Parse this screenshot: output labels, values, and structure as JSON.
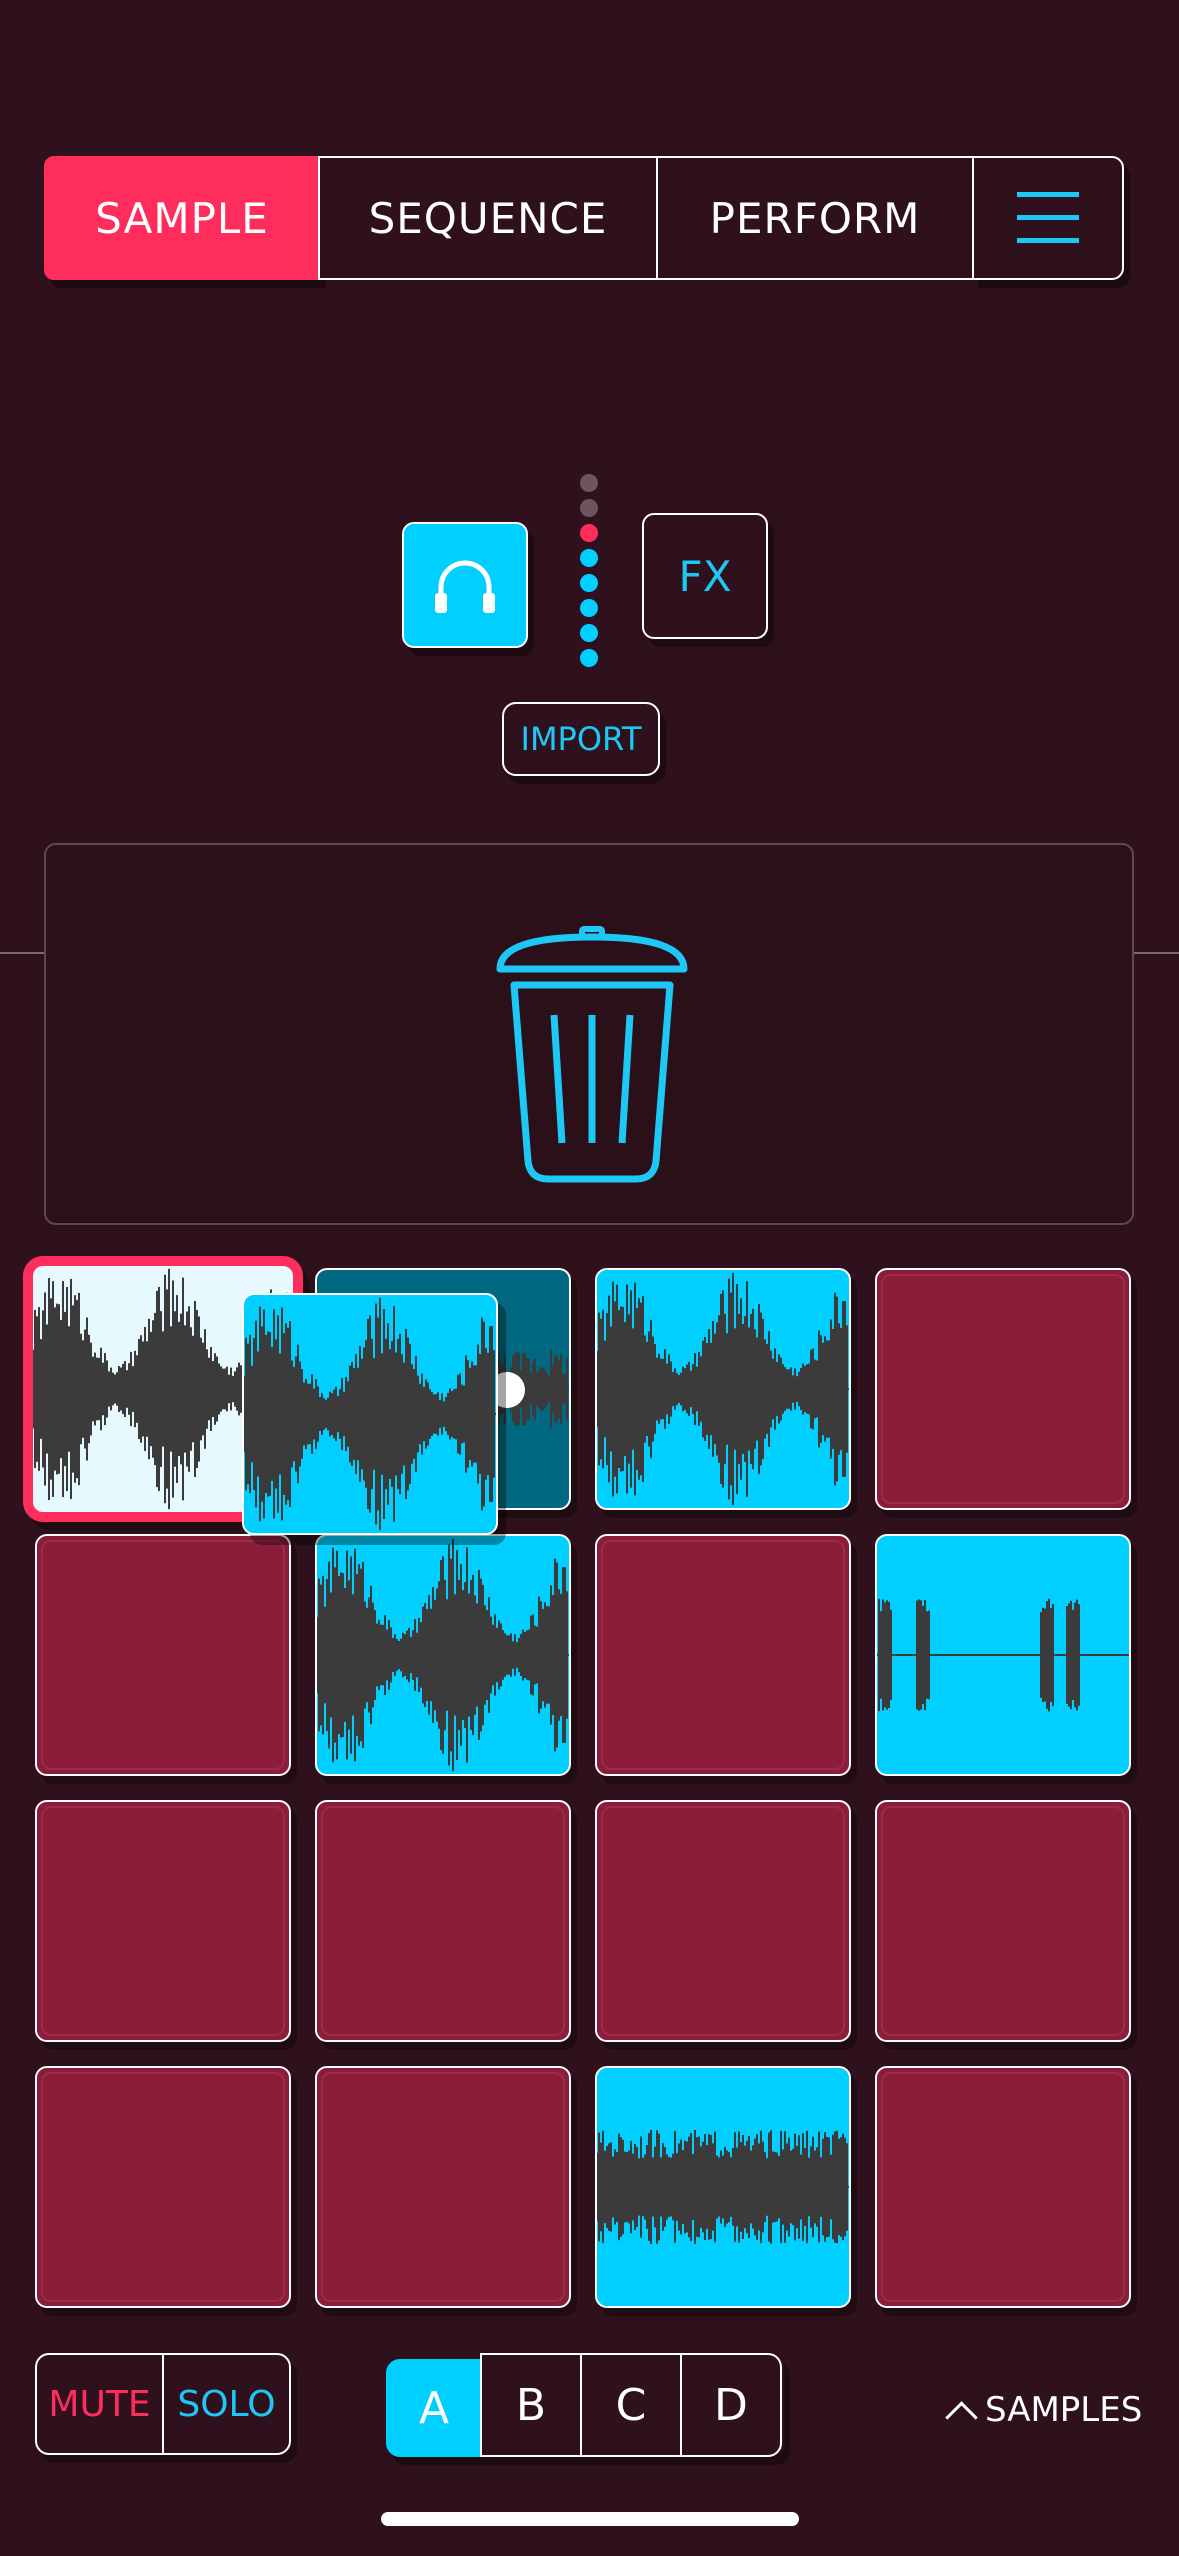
{
  "tabs": {
    "sample": "SAMPLE",
    "sequence": "SEQUENCE",
    "perform": "PERFORM",
    "menu_icon": "hamburger-menu-icon",
    "active": "SAMPLE"
  },
  "controls": {
    "headphones_icon": "headphones-icon",
    "fx_label": "FX",
    "import_label": "IMPORT",
    "level_meter": {
      "total_dots": 8,
      "inactive": 2,
      "peak": 1,
      "active": 5,
      "colors": {
        "inactive": "#6b5660",
        "peak": "#ff2d5c",
        "active": "#00cfff"
      }
    }
  },
  "trash": {
    "icon": "trash-icon"
  },
  "pads": {
    "rows": 4,
    "cols": 4,
    "items": [
      {
        "state": "selected",
        "waveform": "dense"
      },
      {
        "state": "dark",
        "waveform": "partial"
      },
      {
        "state": "sample",
        "waveform": "dense"
      },
      {
        "state": "empty"
      },
      {
        "state": "empty"
      },
      {
        "state": "sample",
        "waveform": "dense"
      },
      {
        "state": "empty"
      },
      {
        "state": "sample",
        "waveform": "sparse"
      },
      {
        "state": "empty"
      },
      {
        "state": "empty"
      },
      {
        "state": "empty"
      },
      {
        "state": "empty"
      },
      {
        "state": "empty"
      },
      {
        "state": "empty"
      },
      {
        "state": "sample",
        "waveform": "flat"
      },
      {
        "state": "empty"
      }
    ],
    "dragged_sample": {
      "waveform": "dense"
    }
  },
  "bottom": {
    "mute": "MUTE",
    "solo": "SOLO",
    "banks": [
      "A",
      "B",
      "C",
      "D"
    ],
    "active_bank": "A",
    "samples_label": "SAMPLES",
    "samples_icon": "caret-up-icon"
  },
  "colors": {
    "background": "#2e111c",
    "accent_red": "#ff2d5c",
    "accent_cyan": "#00cfff",
    "pad_empty": "#8b1c3a",
    "waveform": "#3b3b3b"
  }
}
